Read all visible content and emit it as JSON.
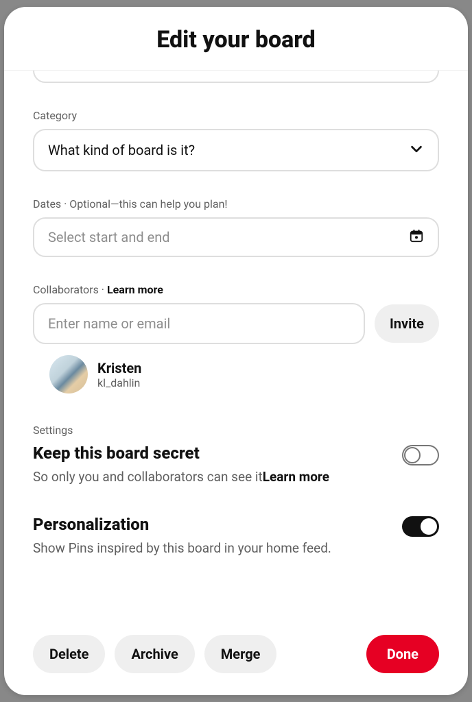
{
  "modal": {
    "title": "Edit your board"
  },
  "category": {
    "label": "Category",
    "placeholder": "What kind of board is it?"
  },
  "dates": {
    "label": "Dates · Optional—this can help you plan!",
    "placeholder": "Select start and end"
  },
  "collaborators": {
    "label_prefix": "Collaborators · ",
    "learn_more": "Learn more",
    "input_placeholder": "Enter name or email",
    "invite_label": "Invite",
    "user": {
      "name": "Kristen",
      "handle": "kl_dahlin"
    }
  },
  "settings": {
    "label": "Settings",
    "secret": {
      "title": "Keep this board secret",
      "desc_prefix": "So only you and collaborators can see it",
      "learn_more": "Learn more",
      "enabled": false
    },
    "personalization": {
      "title": "Personalization",
      "desc": "Show Pins inspired by this board in your home feed.",
      "enabled": true
    }
  },
  "footer": {
    "delete": "Delete",
    "archive": "Archive",
    "merge": "Merge",
    "done": "Done"
  }
}
